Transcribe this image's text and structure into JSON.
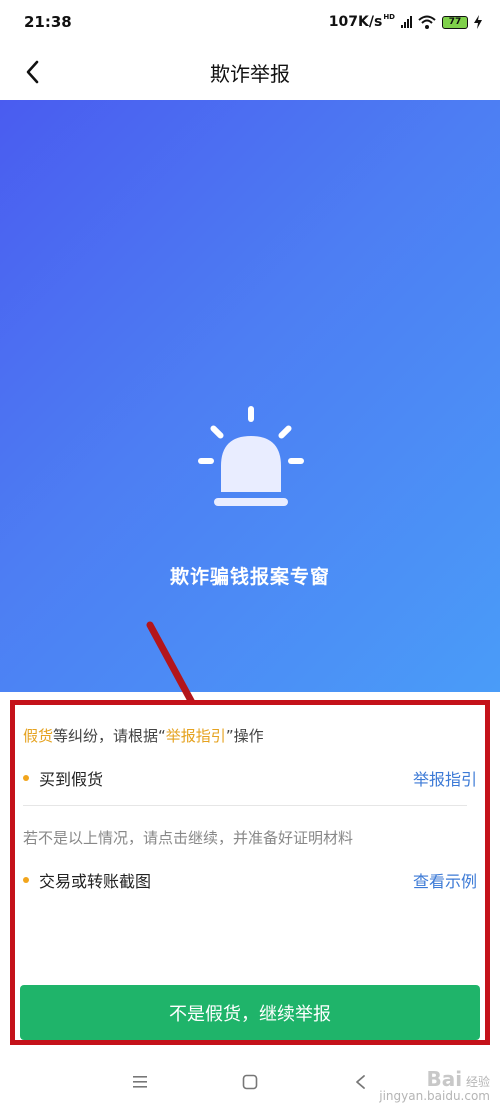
{
  "status_bar": {
    "time": "21:38",
    "network_speed": "107K/s",
    "network_badge": "HD",
    "battery": "77"
  },
  "navbar": {
    "title": "欺诈举报",
    "back_icon": "chevron-left-icon"
  },
  "hero": {
    "icon": "alarm-siren-icon",
    "title": "欺诈骗钱报案专窗",
    "gradient_start": "#4a5cf0",
    "gradient_end": "#4a9cf8"
  },
  "card": {
    "notice": {
      "part1": "假货",
      "part2": "等纠纷，请根据“",
      "part3": "举报指引",
      "part4": "”操作"
    },
    "item1": {
      "label": "买到假货",
      "link": "举报指引"
    },
    "hint": "若不是以上情况，请点击继续，并准备好证明材料",
    "item2": {
      "label": "交易或转账截图",
      "link": "查看示例"
    },
    "button_label": "不是假货，继续举报",
    "button_color": "#1fb46a",
    "highlight_color": "#e5a21f",
    "link_color": "#3c7ad6",
    "annotation_border_color": "#c4121a"
  },
  "system_nav": {
    "menu_icon": "menu-icon",
    "home_icon": "home-square-icon",
    "back_icon": "back-triangle-icon"
  },
  "watermark": {
    "logo": "Bai",
    "text": "经验",
    "domain": "jingyan.baidu.com"
  }
}
